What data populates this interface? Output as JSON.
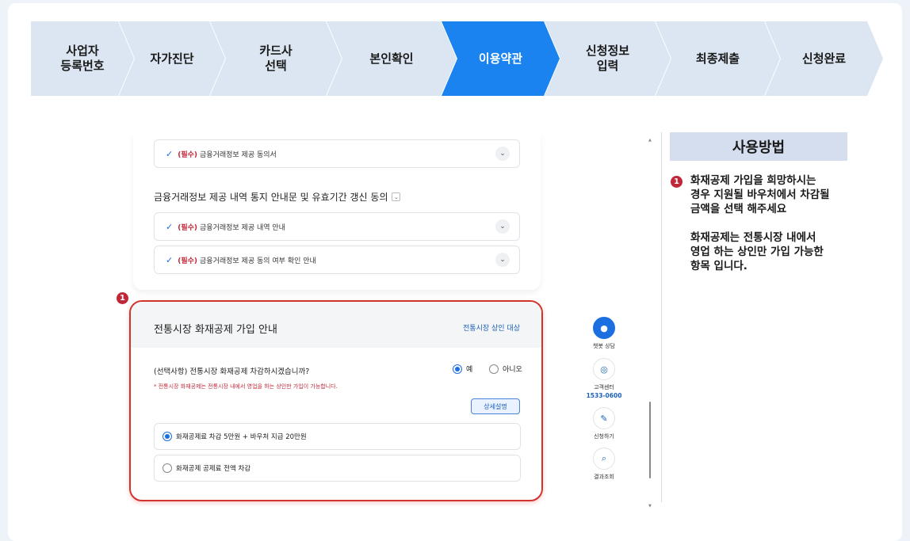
{
  "steps": [
    {
      "label": "사업자\n등록번호",
      "active": false
    },
    {
      "label": "자가진단",
      "active": false
    },
    {
      "label": "카드사\n선택",
      "active": false
    },
    {
      "label": "본인확인",
      "active": false
    },
    {
      "label": "이용약관",
      "active": true
    },
    {
      "label": "신청정보\n입력",
      "active": false
    },
    {
      "label": "최종제출",
      "active": false
    },
    {
      "label": "신청완료",
      "active": false
    }
  ],
  "form": {
    "consent_rows": [
      {
        "required": "(필수)",
        "label": "금융거래정보 제공 동의서"
      },
      {
        "required": "(필수)",
        "label": "금융거래정보 제공 내역 안내"
      },
      {
        "required": "(필수)",
        "label": "금융거래정보 제공 동의 여부 확인 안내"
      }
    ],
    "section_title": "금융거래정보 제공 내역 통지 안내문 및 유효기간 갱신 동의"
  },
  "badge_number": "1",
  "mutual_aid": {
    "title": "전통시장 화재공제 가입 안내",
    "target": "전통시장 상인 대상",
    "question": "(선택사항) 전통시장 화재공제 차감하시겠습니까?",
    "yes": "예",
    "no": "아니오",
    "selected": "yes",
    "note": "* 전통시장 화재공제는 전통시장 내에서 영업을 하는 상인만 가입이 가능합니다.",
    "detail_button": "상세설명",
    "options": [
      {
        "label": "화재공제료 차감 5만원 + 바우처 지급 20만원",
        "selected": true
      },
      {
        "label": "화재공제 공제료 전액 차감",
        "selected": false
      }
    ]
  },
  "quick_menu": {
    "chatbot": "챗봇 상담",
    "center": "고객센터",
    "phone": "1533-0600",
    "apply": "신청하기",
    "result": "결과조회"
  },
  "usage": {
    "title": "사용방법",
    "badge": "1",
    "text": "화재공제 가입을 희망하시는\n경우 지원될 바우처에서 차감될\n금액을 선택 해주세요\n\n화재공제는 전통시장 내에서\n영업 하는 상인만 가입 가능한\n항목 입니다."
  },
  "colors": {
    "active_step": "#1b83f0",
    "inactive_step": "#dce6f2",
    "highlight_border": "#d0342c",
    "required_text": "#c0283a",
    "usage_header": "#d4deee"
  }
}
